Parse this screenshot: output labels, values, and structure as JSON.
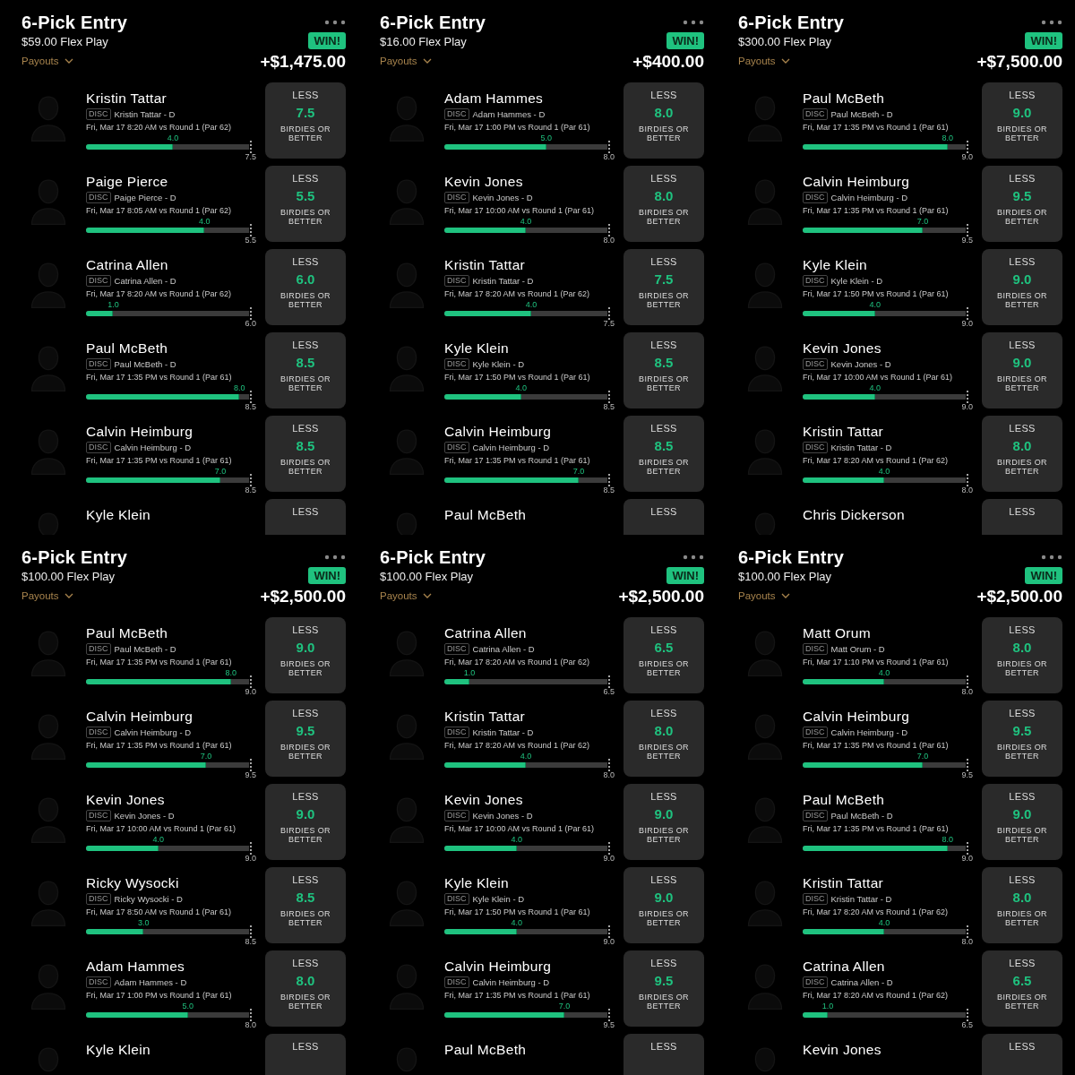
{
  "entries": [
    {
      "title": "6-Pick Entry",
      "stake": "$59.00 Flex Play",
      "payouts": "Payouts",
      "result": "WIN!",
      "winnings": "+$1,475.00",
      "picks": [
        {
          "kind": "full",
          "name": "Kristin Tattar",
          "tag": "DISC",
          "subtitle": "Kristin Tattar - D",
          "schedule": "Fri, Mar 17 8:20 AM  vs Round 1 (Par 62)",
          "actual": "4.0",
          "level": 0.533,
          "bar_end": "7.5",
          "direction": "LESS",
          "line": "7.5",
          "stat": "BIRDIES OR BETTER"
        },
        {
          "kind": "full",
          "name": "Paige Pierce",
          "tag": "DISC",
          "subtitle": "Paige Pierce - D",
          "schedule": "Fri, Mar 17 8:05 AM  vs Round 1 (Par 62)",
          "actual": "4.0",
          "level": 0.727,
          "bar_end": "5.5",
          "direction": "LESS",
          "line": "5.5",
          "stat": "BIRDIES OR BETTER"
        },
        {
          "kind": "full",
          "name": "Catrina Allen",
          "tag": "DISC",
          "subtitle": "Catrina Allen - D",
          "schedule": "Fri, Mar 17 8:20 AM  vs Round 1 (Par 62)",
          "actual": "1.0",
          "level": 0.167,
          "bar_end": "6.0",
          "direction": "LESS",
          "line": "6.0",
          "stat": "BIRDIES OR BETTER"
        },
        {
          "kind": "full",
          "name": "Paul McBeth",
          "tag": "DISC",
          "subtitle": "Paul McBeth - D",
          "schedule": "Fri, Mar 17 1:35 PM  vs Round 1 (Par 61)",
          "actual": "8.0",
          "level": 0.941,
          "bar_end": "8.5",
          "direction": "LESS",
          "line": "8.5",
          "stat": "BIRDIES OR BETTER"
        },
        {
          "kind": "full",
          "name": "Calvin Heimburg",
          "tag": "DISC",
          "subtitle": "Calvin Heimburg - D",
          "schedule": "Fri, Mar 17 1:35 PM  vs Round 1 (Par 61)",
          "actual": "7.0",
          "level": 0.824,
          "bar_end": "8.5",
          "direction": "LESS",
          "line": "8.5",
          "stat": "BIRDIES OR BETTER"
        },
        {
          "kind": "cut",
          "name": "Kyle Klein",
          "direction": "LESS"
        }
      ]
    },
    {
      "title": "6-Pick Entry",
      "stake": "$16.00 Flex Play",
      "payouts": "Payouts",
      "result": "WIN!",
      "winnings": "+$400.00",
      "picks": [
        {
          "kind": "full",
          "name": "Adam Hammes",
          "tag": "DISC",
          "subtitle": "Adam Hammes - D",
          "schedule": "Fri, Mar 17 1:00 PM  vs Round 1 (Par 61)",
          "actual": "5.0",
          "level": 0.625,
          "bar_end": "8.0",
          "direction": "LESS",
          "line": "8.0",
          "stat": "BIRDIES OR BETTER"
        },
        {
          "kind": "full",
          "name": "Kevin Jones",
          "tag": "DISC",
          "subtitle": "Kevin Jones - D",
          "schedule": "Fri, Mar 17 10:00 AM  vs Round 1 (Par 61)",
          "actual": "4.0",
          "level": 0.5,
          "bar_end": "8.0",
          "direction": "LESS",
          "line": "8.0",
          "stat": "BIRDIES OR BETTER"
        },
        {
          "kind": "full",
          "name": "Kristin Tattar",
          "tag": "DISC",
          "subtitle": "Kristin Tattar - D",
          "schedule": "Fri, Mar 17 8:20 AM  vs Round 1 (Par 62)",
          "actual": "4.0",
          "level": 0.533,
          "bar_end": "7.5",
          "direction": "LESS",
          "line": "7.5",
          "stat": "BIRDIES OR BETTER"
        },
        {
          "kind": "full",
          "name": "Kyle Klein",
          "tag": "DISC",
          "subtitle": "Kyle Klein - D",
          "schedule": "Fri, Mar 17 1:50 PM  vs Round 1 (Par 61)",
          "actual": "4.0",
          "level": 0.471,
          "bar_end": "8.5",
          "direction": "LESS",
          "line": "8.5",
          "stat": "BIRDIES OR BETTER"
        },
        {
          "kind": "full",
          "name": "Calvin Heimburg",
          "tag": "DISC",
          "subtitle": "Calvin Heimburg - D",
          "schedule": "Fri, Mar 17 1:35 PM  vs Round 1 (Par 61)",
          "actual": "7.0",
          "level": 0.824,
          "bar_end": "8.5",
          "direction": "LESS",
          "line": "8.5",
          "stat": "BIRDIES OR BETTER"
        },
        {
          "kind": "cut",
          "name": "Paul McBeth",
          "direction": "LESS"
        }
      ]
    },
    {
      "title": "6-Pick Entry",
      "stake": "$300.00 Flex Play",
      "payouts": "Payouts",
      "result": "WIN!",
      "winnings": "+$7,500.00",
      "picks": [
        {
          "kind": "full",
          "name": "Paul McBeth",
          "tag": "DISC",
          "subtitle": "Paul McBeth - D",
          "schedule": "Fri, Mar 17 1:35 PM  vs Round 1 (Par 61)",
          "actual": "8.0",
          "level": 0.889,
          "bar_end": "9.0",
          "direction": "LESS",
          "line": "9.0",
          "stat": "BIRDIES OR BETTER"
        },
        {
          "kind": "full",
          "name": "Calvin Heimburg",
          "tag": "DISC",
          "subtitle": "Calvin Heimburg - D",
          "schedule": "Fri, Mar 17 1:35 PM  vs Round 1 (Par 61)",
          "actual": "7.0",
          "level": 0.737,
          "bar_end": "9.5",
          "direction": "LESS",
          "line": "9.5",
          "stat": "BIRDIES OR BETTER"
        },
        {
          "kind": "full",
          "name": "Kyle Klein",
          "tag": "DISC",
          "subtitle": "Kyle Klein - D",
          "schedule": "Fri, Mar 17 1:50 PM  vs Round 1 (Par 61)",
          "actual": "4.0",
          "level": 0.444,
          "bar_end": "9.0",
          "direction": "LESS",
          "line": "9.0",
          "stat": "BIRDIES OR BETTER"
        },
        {
          "kind": "full",
          "name": "Kevin Jones",
          "tag": "DISC",
          "subtitle": "Kevin Jones - D",
          "schedule": "Fri, Mar 17 10:00 AM  vs Round 1 (Par 61)",
          "actual": "4.0",
          "level": 0.444,
          "bar_end": "9.0",
          "direction": "LESS",
          "line": "9.0",
          "stat": "BIRDIES OR BETTER"
        },
        {
          "kind": "full",
          "name": "Kristin Tattar",
          "tag": "DISC",
          "subtitle": "Kristin Tattar - D",
          "schedule": "Fri, Mar 17 8:20 AM  vs Round 1 (Par 62)",
          "actual": "4.0",
          "level": 0.5,
          "bar_end": "8.0",
          "direction": "LESS",
          "line": "8.0",
          "stat": "BIRDIES OR BETTER"
        },
        {
          "kind": "cut",
          "name": "Chris Dickerson",
          "direction": "LESS"
        }
      ]
    },
    {
      "title": "6-Pick Entry",
      "stake": "$100.00 Flex Play",
      "payouts": "Payouts",
      "result": "WIN!",
      "winnings": "+$2,500.00",
      "picks": [
        {
          "kind": "full",
          "name": "Paul McBeth",
          "tag": "DISC",
          "subtitle": "Paul McBeth - D",
          "schedule": "Fri, Mar 17 1:35 PM  vs Round 1 (Par 61)",
          "actual": "8.0",
          "level": 0.889,
          "bar_end": "9.0",
          "direction": "LESS",
          "line": "9.0",
          "stat": "BIRDIES OR BETTER"
        },
        {
          "kind": "full",
          "name": "Calvin Heimburg",
          "tag": "DISC",
          "subtitle": "Calvin Heimburg - D",
          "schedule": "Fri, Mar 17 1:35 PM  vs Round 1 (Par 61)",
          "actual": "7.0",
          "level": 0.737,
          "bar_end": "9.5",
          "direction": "LESS",
          "line": "9.5",
          "stat": "BIRDIES OR BETTER"
        },
        {
          "kind": "full",
          "name": "Kevin Jones",
          "tag": "DISC",
          "subtitle": "Kevin Jones - D",
          "schedule": "Fri, Mar 17 10:00 AM  vs Round 1 (Par 61)",
          "actual": "4.0",
          "level": 0.444,
          "bar_end": "9.0",
          "direction": "LESS",
          "line": "9.0",
          "stat": "BIRDIES OR BETTER"
        },
        {
          "kind": "full",
          "name": "Ricky Wysocki",
          "tag": "DISC",
          "subtitle": "Ricky Wysocki - D",
          "schedule": "Fri, Mar 17 8:50 AM  vs Round 1 (Par 61)",
          "actual": "3.0",
          "level": 0.353,
          "bar_end": "8.5",
          "direction": "LESS",
          "line": "8.5",
          "stat": "BIRDIES OR BETTER"
        },
        {
          "kind": "full",
          "name": "Adam Hammes",
          "tag": "DISC",
          "subtitle": "Adam Hammes - D",
          "schedule": "Fri, Mar 17 1:00 PM  vs Round 1 (Par 61)",
          "actual": "5.0",
          "level": 0.625,
          "bar_end": "8.0",
          "direction": "LESS",
          "line": "8.0",
          "stat": "BIRDIES OR BETTER"
        },
        {
          "kind": "cut",
          "name": "Kyle Klein",
          "direction": "LESS"
        }
      ]
    },
    {
      "title": "6-Pick Entry",
      "stake": "$100.00 Flex Play",
      "payouts": "Payouts",
      "result": "WIN!",
      "winnings": "+$2,500.00",
      "picks": [
        {
          "kind": "full",
          "name": "Catrina Allen",
          "tag": "DISC",
          "subtitle": "Catrina Allen - D",
          "schedule": "Fri, Mar 17 8:20 AM  vs Round 1 (Par 62)",
          "actual": "1.0",
          "level": 0.154,
          "bar_end": "6.5",
          "direction": "LESS",
          "line": "6.5",
          "stat": "BIRDIES OR BETTER"
        },
        {
          "kind": "full",
          "name": "Kristin Tattar",
          "tag": "DISC",
          "subtitle": "Kristin Tattar - D",
          "schedule": "Fri, Mar 17 8:20 AM  vs Round 1 (Par 62)",
          "actual": "4.0",
          "level": 0.5,
          "bar_end": "8.0",
          "direction": "LESS",
          "line": "8.0",
          "stat": "BIRDIES OR BETTER"
        },
        {
          "kind": "full",
          "name": "Kevin Jones",
          "tag": "DISC",
          "subtitle": "Kevin Jones - D",
          "schedule": "Fri, Mar 17 10:00 AM  vs Round 1 (Par 61)",
          "actual": "4.0",
          "level": 0.444,
          "bar_end": "9.0",
          "direction": "LESS",
          "line": "9.0",
          "stat": "BIRDIES OR BETTER"
        },
        {
          "kind": "full",
          "name": "Kyle Klein",
          "tag": "DISC",
          "subtitle": "Kyle Klein - D",
          "schedule": "Fri, Mar 17 1:50 PM  vs Round 1 (Par 61)",
          "actual": "4.0",
          "level": 0.444,
          "bar_end": "9.0",
          "direction": "LESS",
          "line": "9.0",
          "stat": "BIRDIES OR BETTER"
        },
        {
          "kind": "full",
          "name": "Calvin Heimburg",
          "tag": "DISC",
          "subtitle": "Calvin Heimburg - D",
          "schedule": "Fri, Mar 17 1:35 PM  vs Round 1 (Par 61)",
          "actual": "7.0",
          "level": 0.737,
          "bar_end": "9.5",
          "direction": "LESS",
          "line": "9.5",
          "stat": "BIRDIES OR BETTER"
        },
        {
          "kind": "cut",
          "name": "Paul McBeth",
          "direction": "LESS"
        }
      ]
    },
    {
      "title": "6-Pick Entry",
      "stake": "$100.00 Flex Play",
      "payouts": "Payouts",
      "result": "WIN!",
      "winnings": "+$2,500.00",
      "picks": [
        {
          "kind": "full",
          "name": "Matt Orum",
          "tag": "DISC",
          "subtitle": "Matt Orum - D",
          "schedule": "Fri, Mar 17 1:10 PM  vs Round 1 (Par 61)",
          "actual": "4.0",
          "level": 0.5,
          "bar_end": "8.0",
          "direction": "LESS",
          "line": "8.0",
          "stat": "BIRDIES OR BETTER"
        },
        {
          "kind": "full",
          "name": "Calvin Heimburg",
          "tag": "DISC",
          "subtitle": "Calvin Heimburg - D",
          "schedule": "Fri, Mar 17 1:35 PM  vs Round 1 (Par 61)",
          "actual": "7.0",
          "level": 0.737,
          "bar_end": "9.5",
          "direction": "LESS",
          "line": "9.5",
          "stat": "BIRDIES OR BETTER"
        },
        {
          "kind": "full",
          "name": "Paul McBeth",
          "tag": "DISC",
          "subtitle": "Paul McBeth - D",
          "schedule": "Fri, Mar 17 1:35 PM  vs Round 1 (Par 61)",
          "actual": "8.0",
          "level": 0.889,
          "bar_end": "9.0",
          "direction": "LESS",
          "line": "9.0",
          "stat": "BIRDIES OR BETTER"
        },
        {
          "kind": "full",
          "name": "Kristin Tattar",
          "tag": "DISC",
          "subtitle": "Kristin Tattar - D",
          "schedule": "Fri, Mar 17 8:20 AM  vs Round 1 (Par 62)",
          "actual": "4.0",
          "level": 0.5,
          "bar_end": "8.0",
          "direction": "LESS",
          "line": "8.0",
          "stat": "BIRDIES OR BETTER"
        },
        {
          "kind": "full",
          "name": "Catrina Allen",
          "tag": "DISC",
          "subtitle": "Catrina Allen - D",
          "schedule": "Fri, Mar 17 8:20 AM  vs Round 1 (Par 62)",
          "actual": "1.0",
          "level": 0.154,
          "bar_end": "6.5",
          "direction": "LESS",
          "line": "6.5",
          "stat": "BIRDIES OR BETTER"
        },
        {
          "kind": "cut",
          "name": "Kevin Jones",
          "direction": "LESS"
        }
      ]
    }
  ]
}
